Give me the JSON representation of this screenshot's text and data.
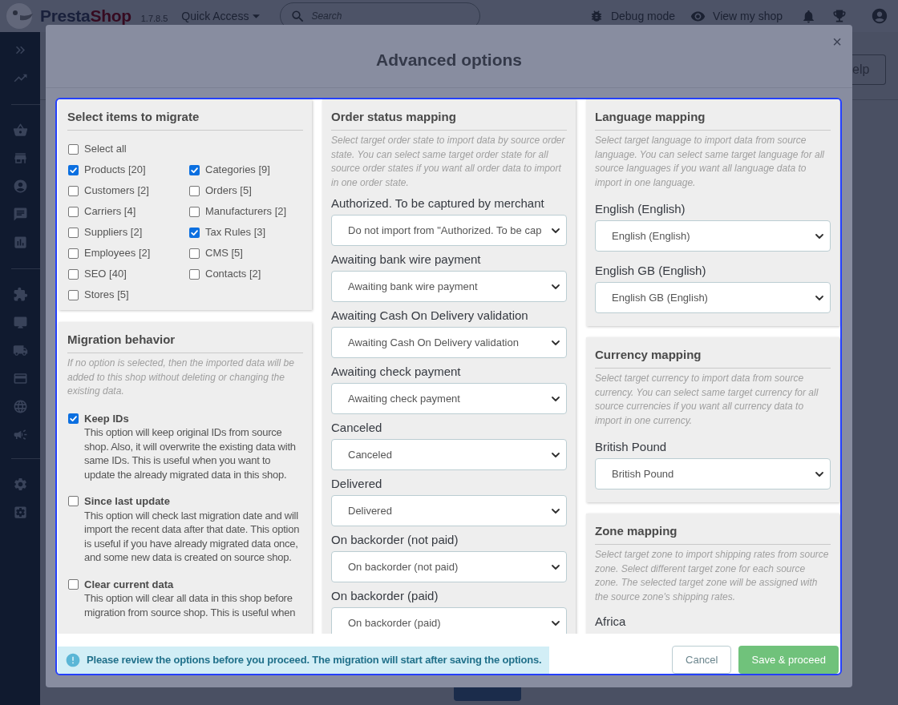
{
  "top_bar": {
    "logo": {
      "primary": "Presta",
      "accent": "Shop"
    },
    "version": "1.7.8.5",
    "quick_access": "Quick Access",
    "search": {
      "placeholder": "Search"
    },
    "debug_mode": "Debug mode",
    "view_shop": "View my shop"
  },
  "page_header": {
    "help_button": "elp"
  },
  "modal": {
    "title": "Advanced options",
    "close": "×",
    "items_panel": {
      "title": "Select items to migrate",
      "select_all": {
        "label": "Select all",
        "checked": false
      },
      "items": [
        {
          "label": "Products [20]",
          "checked": true
        },
        {
          "label": "Categories [9]",
          "checked": true
        },
        {
          "label": "Customers [2]",
          "checked": false
        },
        {
          "label": "Orders [5]",
          "checked": false
        },
        {
          "label": "Carriers [4]",
          "checked": false
        },
        {
          "label": "Manufacturers [2]",
          "checked": false
        },
        {
          "label": "Suppliers [2]",
          "checked": false
        },
        {
          "label": "Tax Rules [3]",
          "checked": true
        },
        {
          "label": "Employees [2]",
          "checked": false
        },
        {
          "label": "CMS [5]",
          "checked": false
        },
        {
          "label": "SEO [40]",
          "checked": false
        },
        {
          "label": "Contacts [2]",
          "checked": false
        },
        {
          "label": "Stores [5]",
          "checked": false
        }
      ]
    },
    "behavior_panel": {
      "title": "Migration behavior",
      "description": "If no option is selected, then the imported data will be added to this shop without deleting or changing the existing data.",
      "options": [
        {
          "label": "Keep IDs",
          "checked": true,
          "description": "This option will keep original IDs from source shop. Also, it will overwrite the existing data with same IDs. This is useful when you want to update the already migrated data in this shop."
        },
        {
          "label": "Since last update",
          "checked": false,
          "description": "This option will check last migration date and will import the recent data after that date. This option is useful if you have already migrated data once, and some new data is created on source shop."
        },
        {
          "label": "Clear current data",
          "checked": false,
          "description": "This option will clear all data in this shop before migration from source shop. This is useful when"
        }
      ]
    },
    "order_status_panel": {
      "title": "Order status mapping",
      "description": "Select target order state to import data by source order state. You can select same target order state for all source order states if you want all order data to import in one order state.",
      "mappings": [
        {
          "label": "Authorized. To be captured by merchant",
          "value": "Do not import from \"Authorized. To be cap"
        },
        {
          "label": "Awaiting bank wire payment",
          "value": "Awaiting bank wire payment"
        },
        {
          "label": "Awaiting Cash On Delivery validation",
          "value": "Awaiting Cash On Delivery validation"
        },
        {
          "label": "Awaiting check payment",
          "value": "Awaiting check payment"
        },
        {
          "label": "Canceled",
          "value": "Canceled"
        },
        {
          "label": "Delivered",
          "value": "Delivered"
        },
        {
          "label": "On backorder (not paid)",
          "value": "On backorder (not paid)"
        },
        {
          "label": "On backorder (paid)",
          "value": "On backorder (paid)"
        }
      ]
    },
    "language_panel": {
      "title": "Language mapping",
      "description": "Select target language to import data from source language. You can select same target language for all source languages if you want all language data to import in one language.",
      "mappings": [
        {
          "label": "English (English)",
          "value": "English (English)"
        },
        {
          "label": "English GB (English)",
          "value": "English GB (English)"
        }
      ]
    },
    "currency_panel": {
      "title": "Currency mapping",
      "description": "Select target currency to import data from source currency. You can select same target currency for all source currencies if you want all currency data to import in one currency.",
      "mappings": [
        {
          "label": "British Pound",
          "value": "British Pound"
        }
      ]
    },
    "zone_panel": {
      "title": "Zone mapping",
      "description": "Select target zone to import shipping rates from source zone. Select different target zone for each source zone. The selected target zone will be assigned with the source zone's shipping rates.",
      "mappings": [
        {
          "label": "Africa"
        }
      ]
    },
    "notice": "Please review the options before you proceed. The migration will start after saving the options.",
    "buttons": [
      {
        "label": "Cancel",
        "kind": "secondary"
      },
      {
        "label": "Save & proceed",
        "kind": "primary"
      }
    ]
  }
}
